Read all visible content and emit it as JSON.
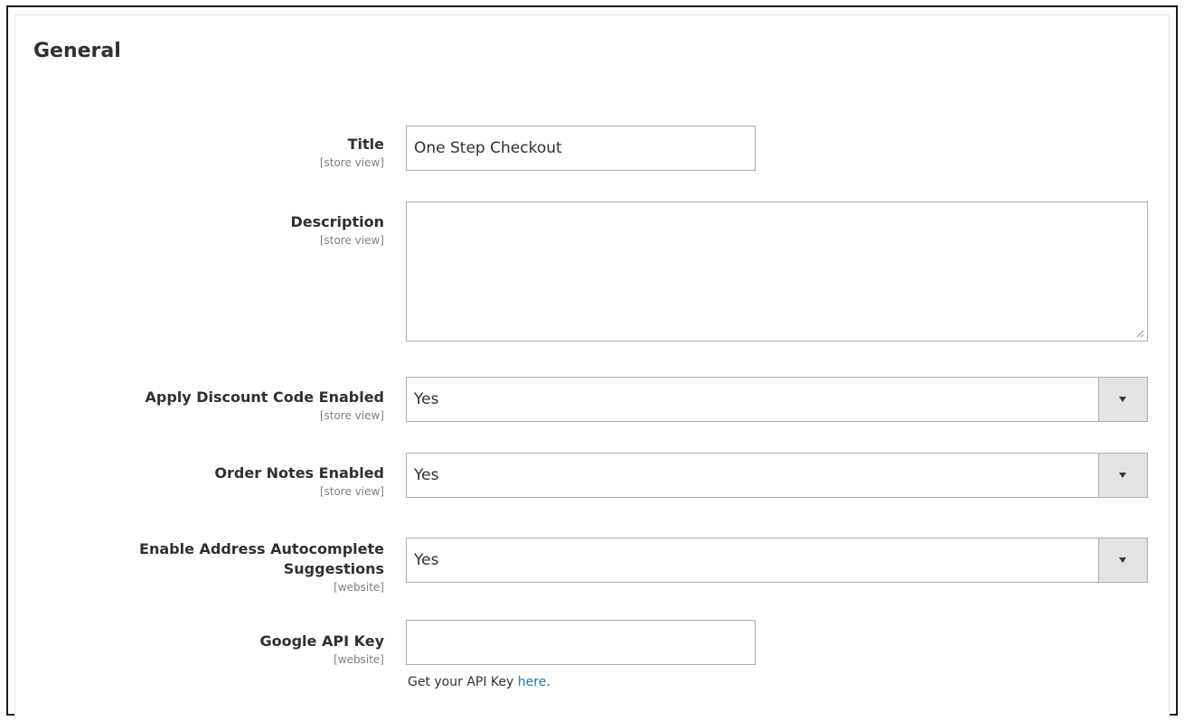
{
  "section": {
    "title": "General"
  },
  "fields": {
    "title": {
      "label": "Title",
      "scope": "[store view]",
      "value": "One Step Checkout"
    },
    "description": {
      "label": "Description",
      "scope": "[store view]",
      "value": ""
    },
    "apply_discount": {
      "label": "Apply Discount Code Enabled",
      "scope": "[store view]",
      "value": "Yes"
    },
    "order_notes": {
      "label": "Order Notes Enabled",
      "scope": "[store view]",
      "value": "Yes"
    },
    "address_autocomplete": {
      "label_line1": "Enable Address Autocomplete",
      "label_line2": "Suggestions",
      "scope": "[website]",
      "value": "Yes"
    },
    "google_api_key": {
      "label": "Google API Key",
      "scope": "[website]",
      "value": "",
      "note_prefix": "Get your API Key ",
      "note_link": "here",
      "note_suffix": "."
    }
  },
  "colors": {
    "link": "#1979c3",
    "border": "#adadad",
    "select_button": "#e3e3e3"
  }
}
